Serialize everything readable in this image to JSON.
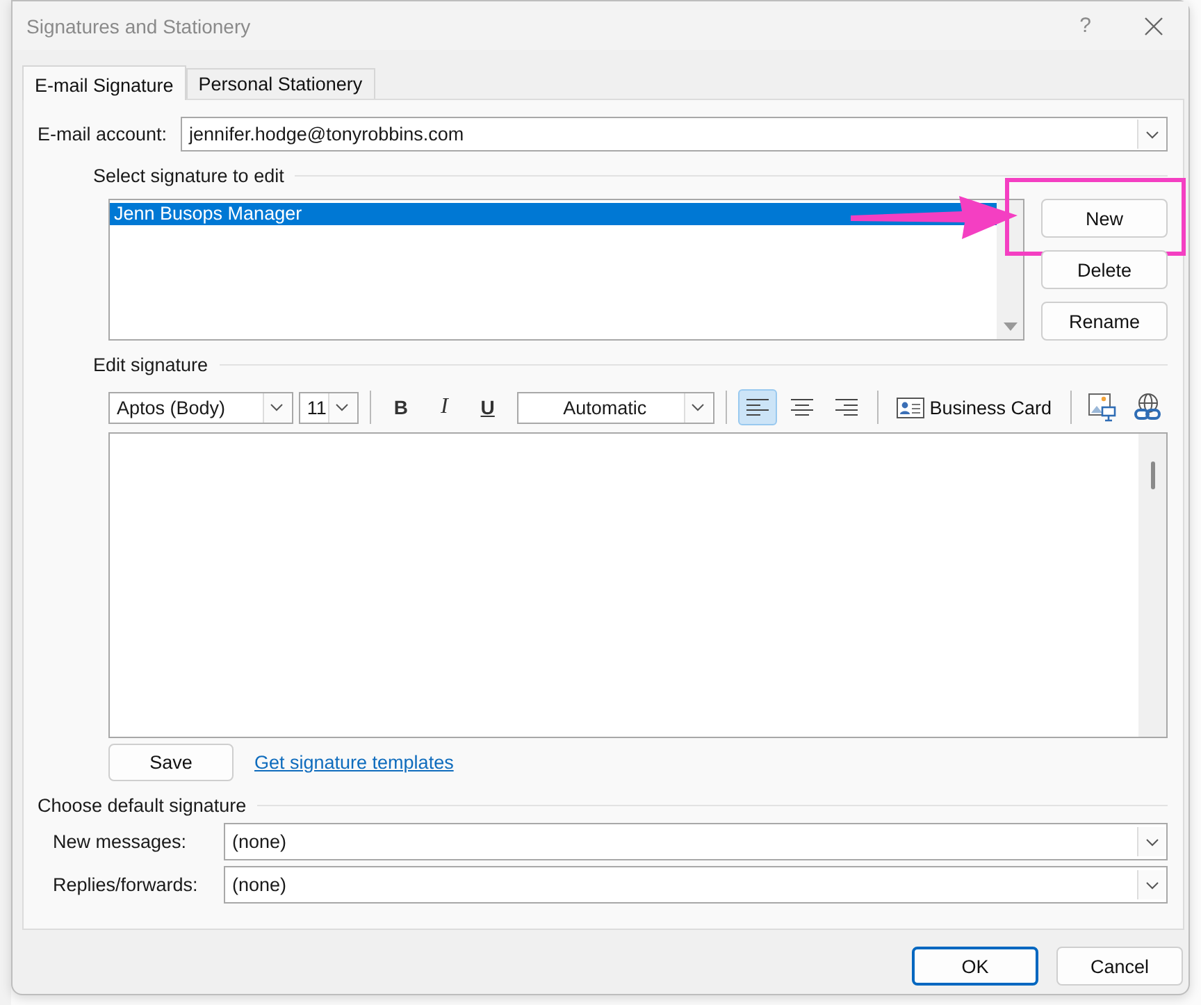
{
  "window": {
    "title": "Signatures and Stationery",
    "help": "?"
  },
  "tabs": [
    {
      "label": "E-mail Signature",
      "selected": true
    },
    {
      "label": "Personal Stationery",
      "selected": false
    }
  ],
  "account": {
    "label": "E-mail account:",
    "value": "jennifer.hodge@tonyrobbins.com"
  },
  "signature_list": {
    "legend": "Select signature to edit",
    "items": [
      {
        "label": "Jenn Busops Manager",
        "selected": true
      }
    ]
  },
  "signature_buttons": [
    {
      "label": "New",
      "highlighted": true
    },
    {
      "label": "Delete",
      "highlighted": false
    },
    {
      "label": "Rename",
      "highlighted": false
    }
  ],
  "editor": {
    "legend": "Edit signature",
    "toolbar": [
      {
        "kind": "font",
        "value": "Aptos (Body)"
      },
      {
        "kind": "size",
        "value": "11"
      },
      {
        "kind": "separator"
      },
      {
        "kind": "bold",
        "label": "B"
      },
      {
        "kind": "italic",
        "label": "I"
      },
      {
        "kind": "underline",
        "label": "U"
      },
      {
        "kind": "color",
        "value": "Automatic"
      },
      {
        "kind": "separator"
      },
      {
        "kind": "align-left",
        "selected": true
      },
      {
        "kind": "align-center",
        "selected": false
      },
      {
        "kind": "align-right",
        "selected": false
      },
      {
        "kind": "separator"
      },
      {
        "kind": "card",
        "label": "Business Card"
      },
      {
        "kind": "separator"
      },
      {
        "kind": "picture"
      },
      {
        "kind": "link"
      }
    ]
  },
  "save": {
    "label": "Save"
  },
  "templates_link": "Get signature templates",
  "defaults": {
    "legend": "Choose default signature",
    "rows": [
      {
        "label": "New messages:",
        "value": "(none)"
      },
      {
        "label": "Replies/forwards:",
        "value": "(none)"
      }
    ]
  },
  "footer": [
    {
      "label": "OK",
      "default": true
    },
    {
      "label": "Cancel",
      "default": false
    }
  ]
}
